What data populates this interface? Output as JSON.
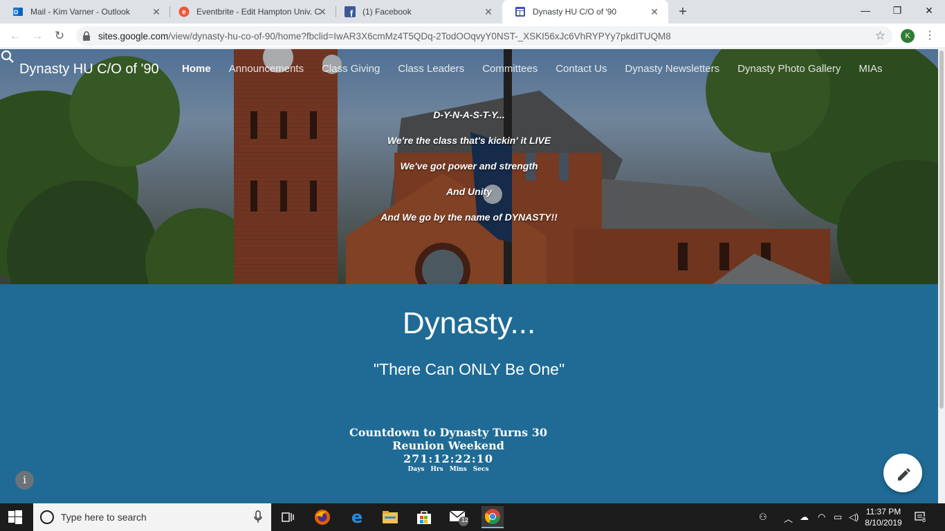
{
  "browser": {
    "tabs": [
      {
        "title": "Mail - Kim Varner - Outlook",
        "icon": "outlook-icon",
        "active": false
      },
      {
        "title": "Eventbrite - Edit Hampton Univ. C",
        "icon": "eventbrite-icon",
        "active": false
      },
      {
        "title": "(1) Facebook",
        "icon": "facebook-icon",
        "active": false
      },
      {
        "title": "Dynasty HU C/O of '90",
        "icon": "google-sites-icon",
        "active": true
      }
    ],
    "url_host": "sites.google.com",
    "url_rest": "/view/dynasty-hu-co-of-90/home?fbclid=IwAR3X6cmMz4T5QDq-2TodOOqvyY0NST-_XSKI56xJc6VhRYPYy7pkdITUQM8",
    "profile_initial": "K"
  },
  "site": {
    "title": "Dynasty HU C/O of '90",
    "nav": [
      "Home",
      "Announcements",
      "Class Giving",
      "Class Leaders",
      "Committees",
      "Contact Us",
      "Dynasty Newsletters",
      "Dynasty Photo Gallery",
      "MIAs"
    ],
    "active_nav": "Home",
    "poem": [
      "D-Y-N-A-S-T-Y...",
      "We're the class that's kickin' it LIVE",
      "We've got power and strength",
      "And Unity",
      "And We go by the name of DYNASTY!!"
    ],
    "heading": "Dynasty...",
    "subheading": "\"There Can ONLY Be One\"",
    "countdown": {
      "title_line1": "Countdown to Dynasty Turns 30",
      "title_line2": "Reunion Weekend",
      "value": "271:12:22:10",
      "units": [
        "Days",
        "Hrs",
        "Mins",
        "Secs"
      ]
    },
    "colors": {
      "section_bg": "#1f6b96",
      "text": "#ffffff"
    }
  },
  "taskbar": {
    "search_placeholder": "Type here to search",
    "mail_badge": "12",
    "time": "11:37 PM",
    "date": "8/10/2019",
    "notification_count": "8"
  }
}
